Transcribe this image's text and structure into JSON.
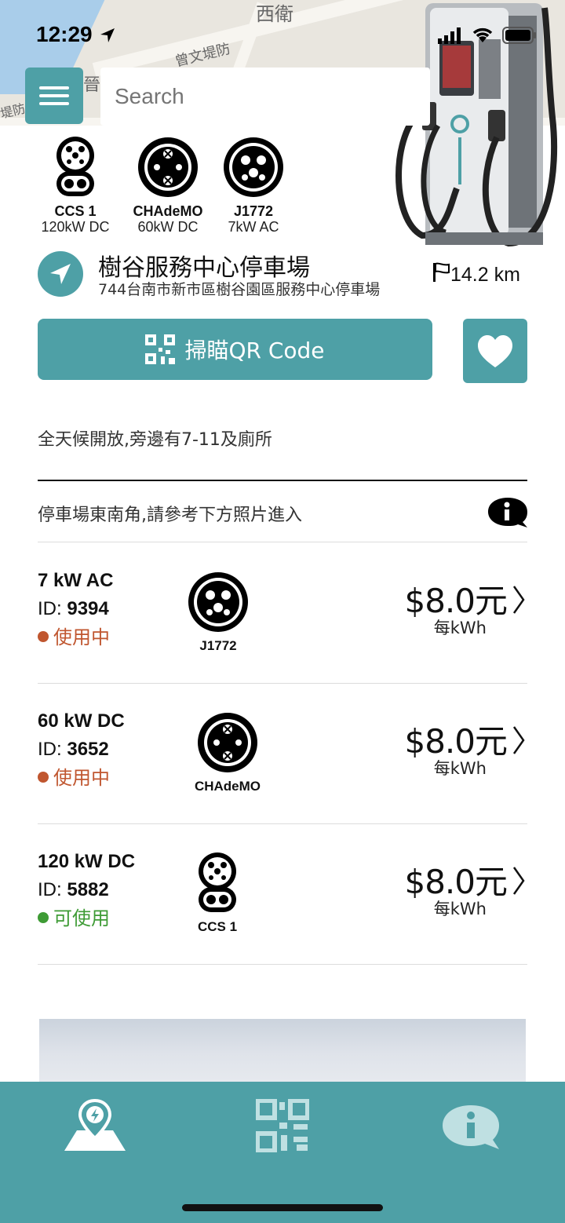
{
  "status_bar": {
    "time": "12:29"
  },
  "map": {
    "label_1": "西衛",
    "label_2": "曾文堤防",
    "label_3": "堤防",
    "label_4": "晉"
  },
  "search": {
    "placeholder": "Search"
  },
  "connectors": [
    {
      "name": "CCS 1",
      "spec": "120kW DC",
      "icon": "ccs1-icon"
    },
    {
      "name": "CHAdeMO",
      "spec": "60kW DC",
      "icon": "chademo-icon"
    },
    {
      "name": "J1772",
      "spec": "7kW AC",
      "icon": "j1772-icon"
    }
  ],
  "location": {
    "title": "樹谷服務中心停車場",
    "address": "744台南市新市區樹谷園區服務中心停車場",
    "distance": "14.2 km"
  },
  "actions": {
    "scan_label": "掃瞄QR Code"
  },
  "notes": {
    "description": "全天候開放,旁邊有7-11及廁所",
    "directions": "停車場東南角,請參考下方照片進入"
  },
  "chargers": [
    {
      "power": "7 kW AC",
      "id_label": "ID:",
      "id": "9394",
      "status": "使用中",
      "status_color": "#c0562f",
      "connector": "J1772",
      "price": "$8.0元",
      "unit": "每kWh"
    },
    {
      "power": "60 kW DC",
      "id_label": "ID:",
      "id": "3652",
      "status": "使用中",
      "status_color": "#c0562f",
      "connector": "CHAdeMO",
      "price": "$8.0元",
      "unit": "每kWh"
    },
    {
      "power": "120 kW DC",
      "id_label": "ID:",
      "id": "5882",
      "status": "可使用",
      "status_color": "#3e9b35",
      "connector": "CCS 1",
      "price": "$8.0元",
      "unit": "每kWh"
    }
  ],
  "tabbar": {
    "tabs": [
      "map-charge-icon",
      "qr-code-icon",
      "info-icon"
    ]
  },
  "colors": {
    "accent": "#4ea0a6",
    "in_use": "#c0562f",
    "available": "#3e9b35"
  }
}
